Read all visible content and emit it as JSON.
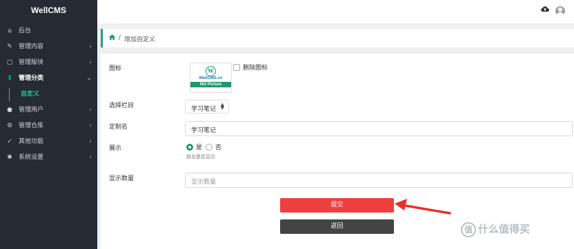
{
  "app": {
    "brand": "WellCMS"
  },
  "sidebar": {
    "items": [
      {
        "label": "后台",
        "icon": "home-icon",
        "glyph": "⌂",
        "chevron": ""
      },
      {
        "label": "管理内容",
        "icon": "edit-icon",
        "glyph": "✎",
        "chevron": "›"
      },
      {
        "label": "管理版块",
        "icon": "columns-icon",
        "glyph": "▢",
        "chevron": "›"
      },
      {
        "label": "管理分类",
        "icon": "sort-icon",
        "glyph": "↕",
        "chevron": "⌄"
      },
      {
        "label": "管理用户",
        "icon": "user-icon",
        "glyph": "●",
        "chevron": "›"
      },
      {
        "label": "管理仓库",
        "icon": "cogs-icon",
        "glyph": "⚙",
        "chevron": "›"
      },
      {
        "label": "其他功能",
        "icon": "wrench-icon",
        "glyph": "✓",
        "chevron": "›"
      },
      {
        "label": "系统设置",
        "icon": "gear-icon",
        "glyph": "✱",
        "chevron": "›"
      }
    ],
    "subitem": {
      "label": "自定义"
    }
  },
  "breadcrumb": {
    "home_icon": "home-icon",
    "separator": "/",
    "current": "增加自定义"
  },
  "form": {
    "icon_label": "图标",
    "picture": {
      "logo_letter": "W",
      "site": "WellCMS.cn",
      "placeholder": "NO Picture"
    },
    "delete_icon_label": "删除图标",
    "category_label": "选择栏目",
    "category_value": "学习笔记",
    "custom_name_label": "定制名",
    "custom_name_value": "学习笔记",
    "display_label": "展示",
    "display_yes": "是",
    "display_no": "否",
    "display_hint": "前台是否显示",
    "display_selected": "是",
    "count_label": "显示数量",
    "count_placeholder": "显示数量",
    "submit_label": "提交",
    "back_label": "返回"
  },
  "colors": {
    "sidebar_bg": "#252a33",
    "accent": "#20c997",
    "submit": "#ec4040",
    "back": "#444444"
  },
  "watermark": {
    "text": "什么值得买",
    "glyph": "值"
  }
}
